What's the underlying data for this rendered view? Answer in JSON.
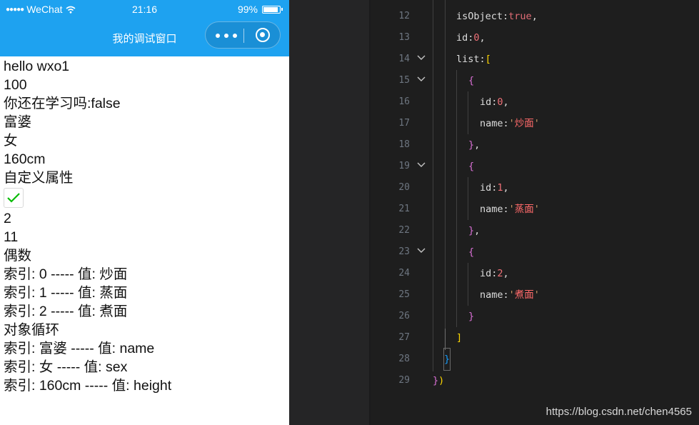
{
  "status_bar": {
    "carrier": "WeChat",
    "time": "21:16",
    "battery_text": "99%",
    "battery_level": 0.99
  },
  "nav": {
    "title": "我的调试窗口"
  },
  "page_lines": [
    "hello wxo1",
    "100",
    "你还在学习吗:false",
    "富婆",
    "女",
    "160cm",
    "自定义属性"
  ],
  "checkbox": {
    "checked": true
  },
  "page_lines_after": [
    "2",
    "11",
    "偶数",
    "索引: 0 ----- 值: 炒面",
    "索引: 1 ----- 值: 蒸面",
    "索引: 2 ----- 值: 煮面",
    "对象循环",
    "索引: 富婆 ----- 值: name",
    "索引: 女 ----- 值: sex",
    "索引: 160cm ----- 值: height"
  ],
  "editor": {
    "line_numbers": [
      "12",
      "13",
      "14",
      "15",
      "16",
      "17",
      "18",
      "19",
      "20",
      "21",
      "22",
      "23",
      "24",
      "25",
      "26",
      "27",
      "28",
      "29"
    ],
    "code": {
      "l12_key": "isObject",
      "l12_val": "true",
      "l13_key": "id",
      "l13_val": "0",
      "l14_key": "list",
      "l16_key": "id",
      "l16_val": "0",
      "l17_key": "name",
      "l17_val": "炒面",
      "l20_key": "id",
      "l20_val": "1",
      "l21_key": "name",
      "l21_val": "蒸面",
      "l24_key": "id",
      "l24_val": "2",
      "l25_key": "name",
      "l25_val": "煮面"
    }
  },
  "watermark": "https://blog.csdn.net/chen4565",
  "colors": {
    "nav_blue": "#1ea2f0",
    "editor_bg": "#1e1e1e",
    "checkbox_green": "#09bb07"
  }
}
